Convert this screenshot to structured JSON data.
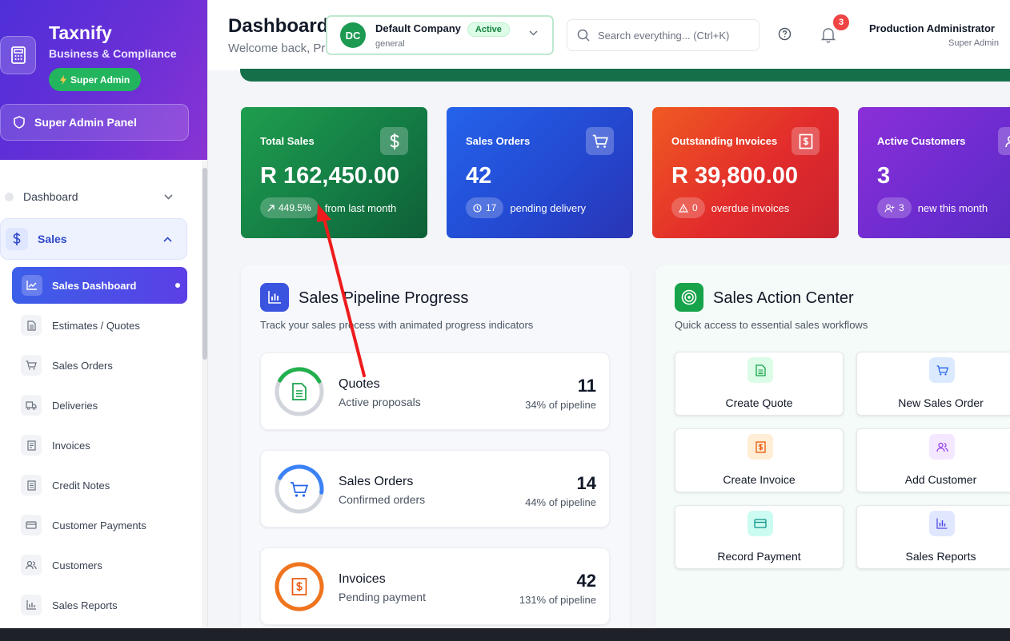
{
  "brand": {
    "name": "Taxnify",
    "subtitle": "Business & Compliance",
    "role_pill": "Super Admin",
    "panel_label": "Super Admin Panel"
  },
  "nav": {
    "dashboard_label": "Dashboard",
    "sales_label": "Sales",
    "active_item": "Sales Dashboard",
    "items": [
      {
        "label": "Estimates / Quotes",
        "icon": "document-icon"
      },
      {
        "label": "Sales Orders",
        "icon": "cart-icon"
      },
      {
        "label": "Deliveries",
        "icon": "truck-icon"
      },
      {
        "label": "Invoices",
        "icon": "receipt-icon"
      },
      {
        "label": "Credit Notes",
        "icon": "note-icon"
      },
      {
        "label": "Customer Payments",
        "icon": "card-icon"
      },
      {
        "label": "Customers",
        "icon": "users-icon"
      },
      {
        "label": "Sales Reports",
        "icon": "bar-chart-icon"
      }
    ]
  },
  "header": {
    "title": "Dashboard",
    "subtitle": "Welcome back, Production Administrator",
    "company": {
      "initials": "DC",
      "name": "Default Company",
      "status": "Active",
      "sub": "general"
    },
    "search_placeholder": "Search everything... (Ctrl+K)",
    "notifications_count": "3",
    "user_name": "Production Administrator",
    "user_role": "Super Admin"
  },
  "stats": [
    {
      "title": "Total Sales",
      "value": "R 162,450.00",
      "chip": "449.5%",
      "note": "from last month"
    },
    {
      "title": "Sales Orders",
      "value": "42",
      "chip": "17",
      "note": "pending delivery"
    },
    {
      "title": "Outstanding Invoices",
      "value": "R 39,800.00",
      "chip": "0",
      "note": "overdue invoices"
    },
    {
      "title": "Active Customers",
      "value": "3",
      "chip": "3",
      "note": "new this month"
    }
  ],
  "pipeline": {
    "title": "Sales Pipeline Progress",
    "subtitle": "Track your sales process with animated progress indicators",
    "items": [
      {
        "name": "Quotes",
        "desc": "Active proposals",
        "count": "11",
        "pct_label": "34% of pipeline",
        "progress": 0.34,
        "color": "#22b04e"
      },
      {
        "name": "Sales Orders",
        "desc": "Confirmed orders",
        "count": "14",
        "pct_label": "44% of pipeline",
        "progress": 0.44,
        "color": "#3b82f6"
      },
      {
        "name": "Invoices",
        "desc": "Pending payment",
        "count": "42",
        "pct_label": "131% of pipeline",
        "progress": 1.0,
        "color": "#f0731e"
      }
    ]
  },
  "actions": {
    "title": "Sales Action Center",
    "subtitle": "Quick access to essential sales workflows",
    "buttons": [
      {
        "label": "Create Quote"
      },
      {
        "label": "New Sales Order"
      },
      {
        "label": "Create Invoice"
      },
      {
        "label": "Add Customer"
      },
      {
        "label": "Record Payment"
      },
      {
        "label": "Sales Reports"
      }
    ]
  },
  "colors": {
    "accent": "#4f46e5",
    "success": "#16a34a",
    "danger": "#ef4444",
    "annotation": "#ee1c1c"
  }
}
